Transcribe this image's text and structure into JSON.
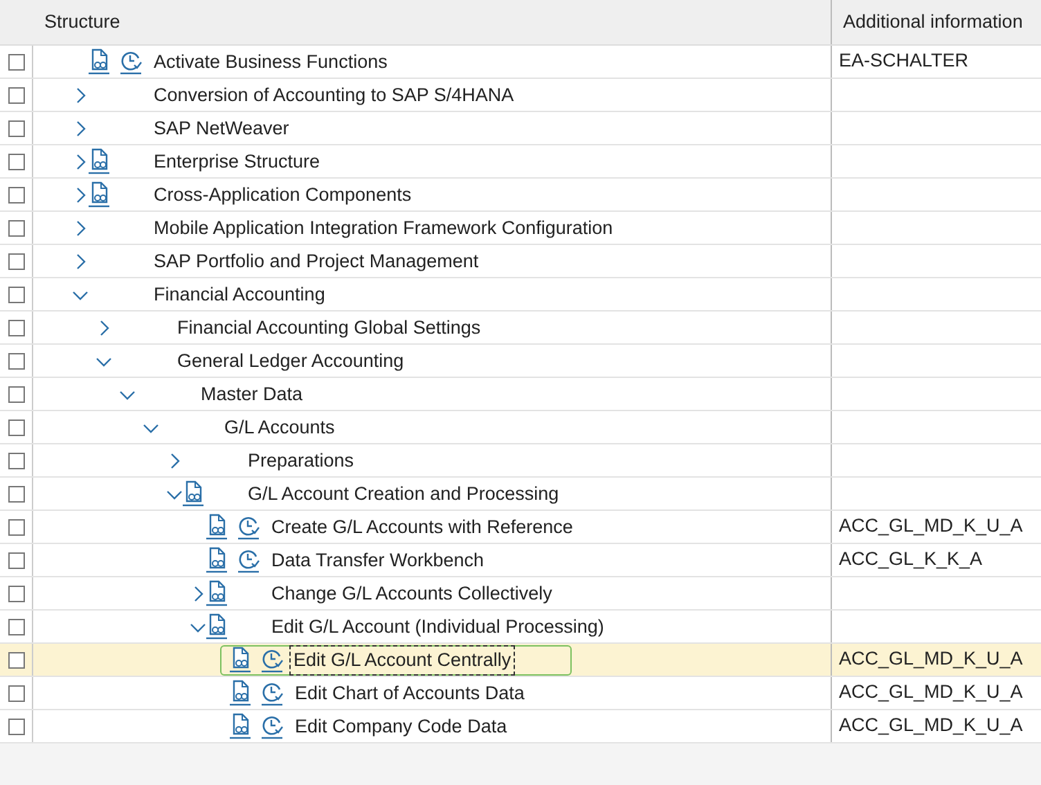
{
  "columns": [
    "Structure",
    "Additional information"
  ],
  "tree": [
    {
      "label": "Activate Business Functions",
      "kind": "activity",
      "checked": false,
      "selected": false,
      "info": "EA-SCHALTER"
    },
    {
      "label": "Conversion of Accounting to SAP S/4HANA",
      "kind": "node",
      "expanded": false,
      "checked": false,
      "selected": false
    },
    {
      "label": "SAP NetWeaver",
      "kind": "node",
      "expanded": false,
      "checked": false,
      "selected": false
    },
    {
      "label": "Enterprise Structure",
      "kind": "doc_node",
      "expanded": false,
      "checked": false,
      "selected": false
    },
    {
      "label": "Cross-Application Components",
      "kind": "doc_node",
      "expanded": false,
      "checked": false,
      "selected": false
    },
    {
      "label": "Mobile Application Integration Framework Configuration",
      "kind": "node",
      "expanded": false,
      "checked": false,
      "selected": false
    },
    {
      "label": "SAP Portfolio and Project Management",
      "kind": "node",
      "expanded": false,
      "checked": false,
      "selected": false
    },
    {
      "label": "Financial Accounting",
      "kind": "node",
      "expanded": true,
      "checked": false,
      "selected": false,
      "children": [
        {
          "label": "Financial Accounting Global Settings",
          "kind": "node",
          "expanded": false,
          "checked": false,
          "selected": false
        },
        {
          "label": "General Ledger Accounting",
          "kind": "node",
          "expanded": true,
          "checked": false,
          "selected": false,
          "children": [
            {
              "label": "Master Data",
              "kind": "node",
              "expanded": true,
              "checked": false,
              "selected": false,
              "children": [
                {
                  "label": "G/L Accounts",
                  "kind": "node",
                  "expanded": true,
                  "checked": false,
                  "selected": false,
                  "children": [
                    {
                      "label": "Preparations",
                      "kind": "node",
                      "expanded": false,
                      "checked": false,
                      "selected": false
                    },
                    {
                      "label": "G/L Account Creation and Processing",
                      "kind": "doc_node",
                      "expanded": true,
                      "checked": false,
                      "selected": false,
                      "children": [
                        {
                          "label": "Create G/L Accounts with Reference",
                          "kind": "activity",
                          "checked": false,
                          "selected": false,
                          "info": "ACC_GL_MD_K_U_A"
                        },
                        {
                          "label": "Data Transfer Workbench",
                          "kind": "activity",
                          "checked": false,
                          "selected": false,
                          "info": "ACC_GL_K_K_A"
                        },
                        {
                          "label": "Change G/L Accounts Collectively",
                          "kind": "doc_node",
                          "expanded": false,
                          "checked": false,
                          "selected": false
                        },
                        {
                          "label": "Edit G/L Account (Individual Processing)",
                          "kind": "doc_node",
                          "expanded": true,
                          "checked": false,
                          "selected": false,
                          "children": [
                            {
                              "label": "Edit G/L Account Centrally",
                              "kind": "activity",
                              "checked": false,
                              "selected": true,
                              "info": "ACC_GL_MD_K_U_A"
                            },
                            {
                              "label": "Edit Chart of Accounts Data",
                              "kind": "activity",
                              "checked": false,
                              "selected": false,
                              "info": "ACC_GL_MD_K_U_A"
                            },
                            {
                              "label": "Edit Company Code Data",
                              "kind": "activity",
                              "checked": false,
                              "selected": false,
                              "info": "ACC_GL_MD_K_U_A"
                            }
                          ]
                        }
                      ]
                    }
                  ]
                }
              ]
            }
          ]
        }
      ]
    }
  ]
}
